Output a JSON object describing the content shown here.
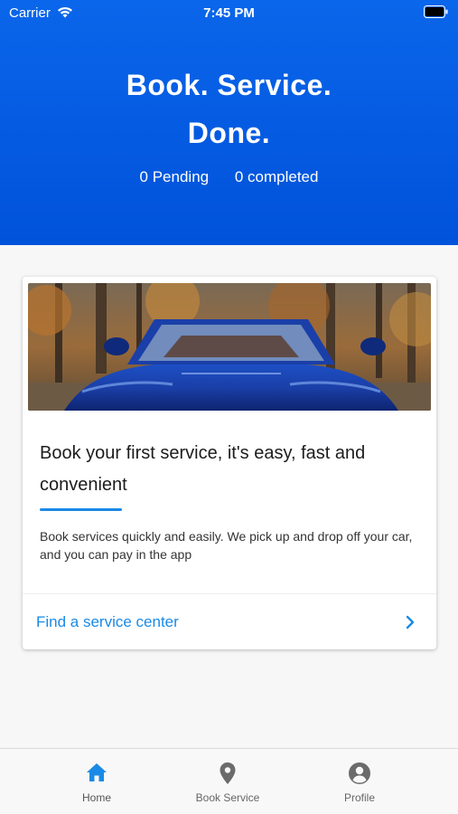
{
  "status_bar": {
    "carrier": "Carrier",
    "time": "7:45 PM",
    "wifi_icon": "wifi-icon",
    "battery_icon": "battery-icon"
  },
  "hero": {
    "title_line1": "Book. Service.",
    "title_line2": "Done.",
    "pending": "0 Pending",
    "completed": "0 completed",
    "background_color": "#0a66ea"
  },
  "card": {
    "image_description_icon": "car-photo",
    "title": "Book your first service, it's easy, fast and convenient",
    "description": "Book services quickly and easily. We pick up and drop off your car, and you can pay in the app",
    "link_label": "Find a service center",
    "link_icon": "chevron-right-icon",
    "accent_color": "#1a8ae6"
  },
  "tabbar": {
    "tabs": [
      {
        "label": "Home",
        "icon": "home-icon",
        "active": true
      },
      {
        "label": "Book Service",
        "icon": "location-pin-icon",
        "active": false
      },
      {
        "label": "Profile",
        "icon": "profile-icon",
        "active": false
      }
    ],
    "active_color": "#1a8ae6",
    "inactive_color": "#6b6b6b"
  }
}
